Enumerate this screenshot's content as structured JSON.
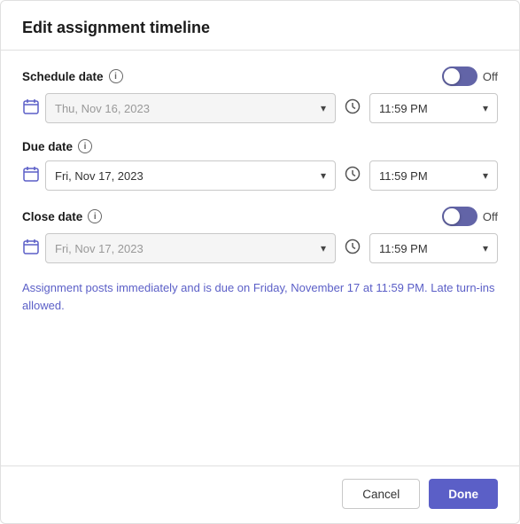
{
  "dialog": {
    "title": "Edit assignment timeline",
    "schedule_date": {
      "label": "Schedule date",
      "toggle_state": "Off",
      "date_placeholder": "Thu, Nov 16, 2023",
      "time_value": "11:59 PM",
      "disabled": true
    },
    "due_date": {
      "label": "Due date",
      "date_value": "Fri, Nov 17, 2023",
      "time_value": "11:59 PM",
      "disabled": false
    },
    "close_date": {
      "label": "Close date",
      "toggle_state": "Off",
      "date_placeholder": "Fri, Nov 17, 2023",
      "time_value": "11:59 PM",
      "disabled": true
    },
    "info_text": "Assignment posts immediately and is due on Friday, November 17 at 11:59 PM. Late turn-ins allowed.",
    "footer": {
      "cancel_label": "Cancel",
      "done_label": "Done"
    }
  }
}
